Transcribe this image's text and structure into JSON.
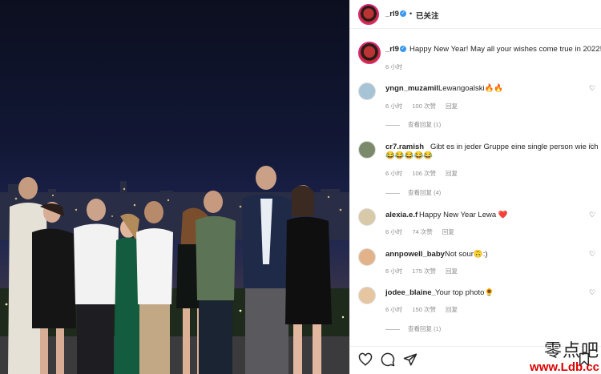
{
  "post": {
    "author": "_rl9",
    "follow_status": "已关注",
    "separator": "•",
    "caption": "Happy New Year! May all your wishes come true in 2022!",
    "caption_time": "6 小时"
  },
  "comments": [
    {
      "user": "yngn_muzamil",
      "text": "Lewangoalski🔥🔥",
      "time": "6 小时",
      "likes": "100 次赞",
      "reply": "回复",
      "replies": "查看回复 (1)",
      "avatar_color": "#a7c3d6"
    },
    {
      "user": "cr7.ramish",
      "text": "Gibt es in jeder Gruppe eine single person wie ich",
      "emoji": "😂😂😂😂😂",
      "time": "6 小时",
      "likes": "106 次赞",
      "reply": "回复",
      "replies": "查看回复 (4)",
      "avatar_color": "#7a8a6a"
    },
    {
      "user": "alexia.e.f",
      "text": "Happy New Year Lewa ❤️",
      "time": "6 小时",
      "likes": "74 次赞",
      "reply": "回复",
      "replies": "",
      "avatar_color": "#d8c9a8"
    },
    {
      "user": "annpowell_baby",
      "text": "Not sour🙃:)",
      "time": "6 小时",
      "likes": "175 次赞",
      "reply": "回复",
      "replies": "",
      "avatar_color": "#e2b38a"
    },
    {
      "user": "jodee_blaine_",
      "text": "Your top photo🌻",
      "time": "6 小时",
      "likes": "150 次赞",
      "reply": "回复",
      "replies": "查看回复 (1)",
      "avatar_color": "#e6c6a0"
    }
  ],
  "icons": [
    "heart-icon",
    "comment-icon",
    "share-icon",
    "bookmark-icon",
    "verified-icon"
  ],
  "watermark": {
    "cn": "零点吧",
    "url": "www.Ldb.cc"
  },
  "colors": {
    "verified": "#3897f0",
    "muted": "#8e8e8e",
    "watermark_url": "#dd0000"
  }
}
